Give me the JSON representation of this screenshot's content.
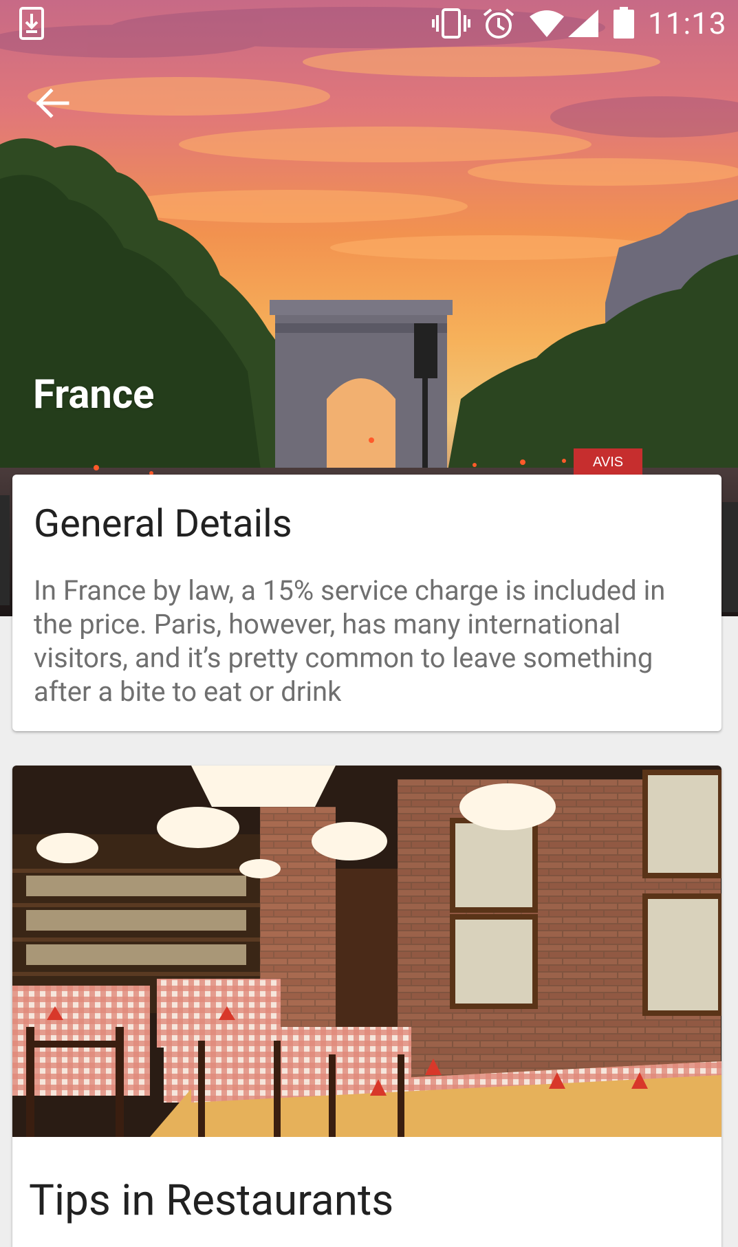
{
  "status_bar": {
    "time": "11:13",
    "icons": [
      "download-icon",
      "vibrate-icon",
      "alarm-icon",
      "wifi-icon",
      "signal-icon",
      "battery-icon"
    ]
  },
  "header": {
    "back_icon": "arrow-back-icon",
    "title": "France"
  },
  "general_details": {
    "title": "General Details",
    "body": "In France by law, a 15% service charge is included in the price. Paris, however, has many international visitors, and it’s pretty common to leave something after a bite to eat or drink"
  },
  "tips_card": {
    "image": "restaurant-interior-image",
    "title": "Tips in Restaurants"
  },
  "colors": {
    "sky_top": "#d8697a",
    "sky_orange": "#f39a52",
    "trees": "#2f4a22",
    "card_bg": "#ffffff",
    "body_text": "#6f6f6f",
    "title_text": "#212121"
  }
}
